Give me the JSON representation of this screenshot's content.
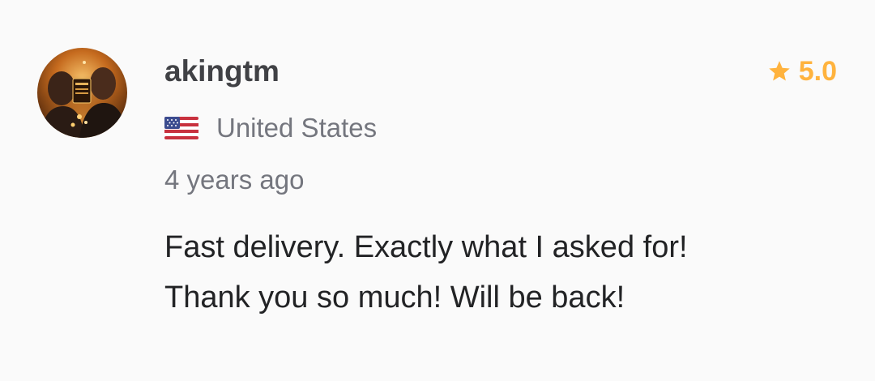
{
  "review": {
    "username": "akingtm",
    "country": "United States",
    "country_flag_icon": "us-flag-icon",
    "rating_icon": "star-icon",
    "rating": "5.0",
    "time_ago": "4 years ago",
    "text": "Fast delivery. Exactly what I asked for!\nThank you so much! Will be back!"
  },
  "colors": {
    "background": "#fafafa",
    "rating_accent": "#ffb33e",
    "username": "#404145",
    "secondary_text": "#74767e",
    "body_text": "#222325"
  }
}
